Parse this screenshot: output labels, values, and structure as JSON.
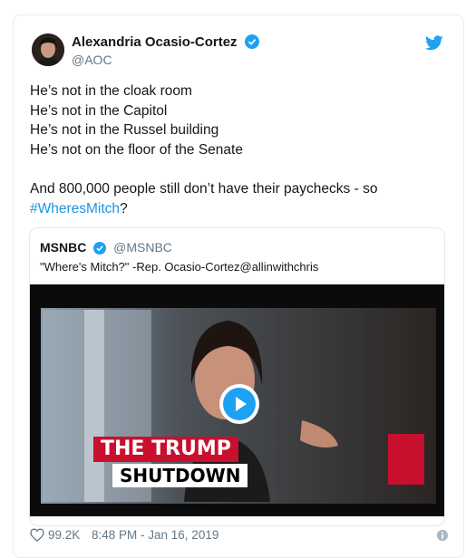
{
  "tweet": {
    "author_name": "Alexandria Ocasio-Cortez",
    "author_handle": "@AOC",
    "lines": [
      "He’s not in the cloak room",
      "He’s not in the Capitol",
      "He’s not in the Russel building",
      "He’s not on the floor of the Senate"
    ],
    "paragraph2": "And 800,000 people still don’t have their paychecks - so",
    "hashtag": "#WheresMitch",
    "hashtag_suffix": "?",
    "likes": "99.2K",
    "timestamp": "8:48 PM - Jan 16, 2019"
  },
  "quoted_tweet": {
    "name": "MSNBC",
    "handle": "@MSNBC",
    "text": "\"Where's Mitch?\" -Rep. Ocasio-Cortez@allinwithchris",
    "video": {
      "banner_top": "THE TRUMP",
      "banner_bottom": "SHUTDOWN"
    }
  },
  "colors": {
    "twitter_blue": "#1da1f2",
    "hashtag": "#1b95e0",
    "banner_red": "#c8102e",
    "muted_text": "#657786"
  },
  "icons": [
    "verified-badge-icon",
    "twitter-bird-icon",
    "play-icon",
    "heart-icon",
    "info-icon"
  ]
}
